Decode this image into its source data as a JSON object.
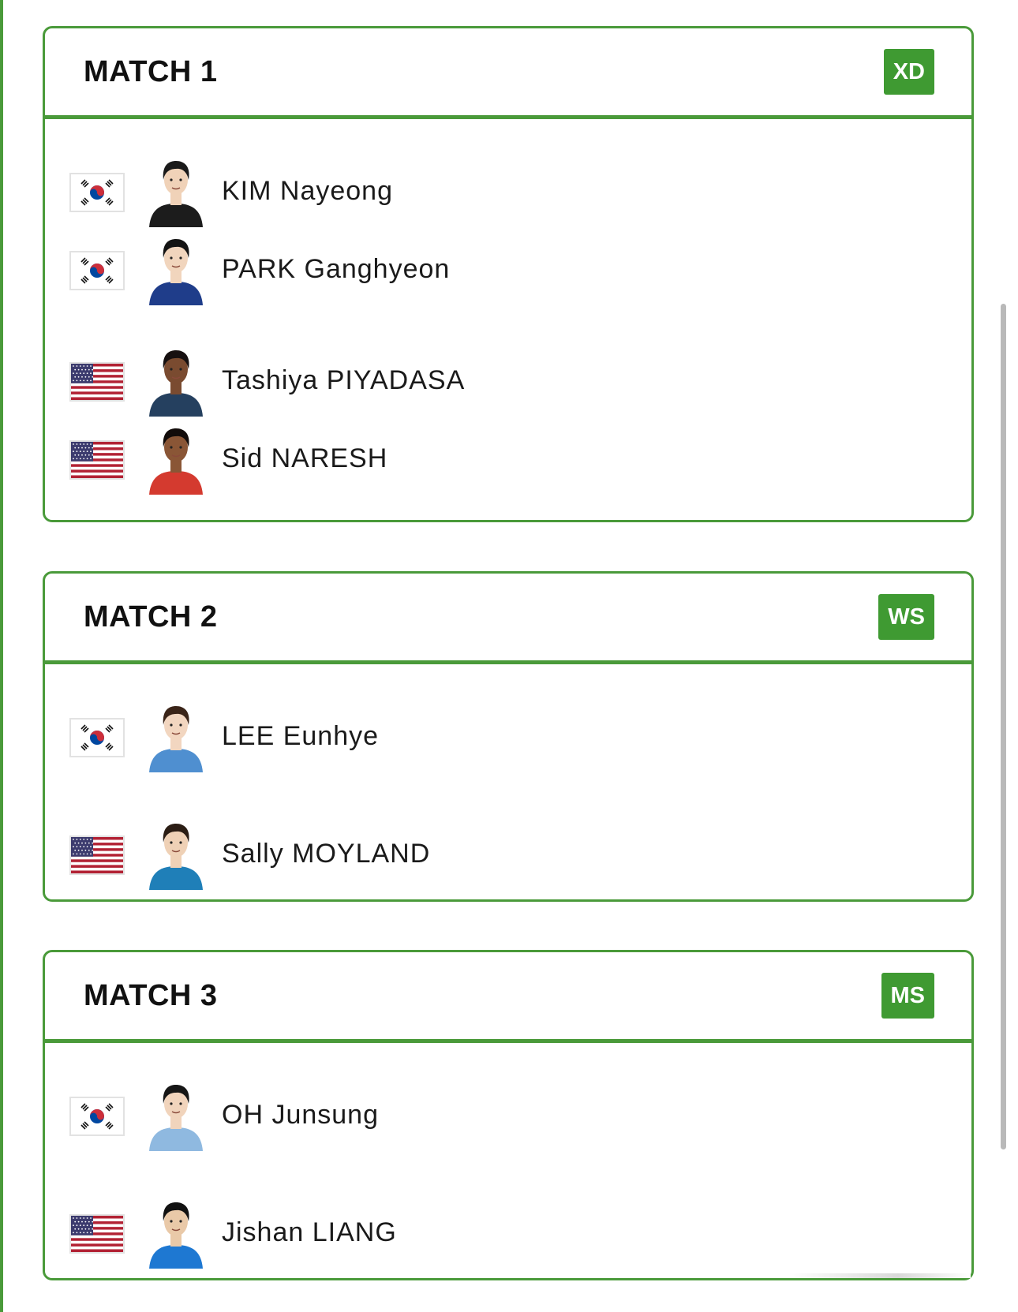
{
  "colors": {
    "accent": "#4a9a3a",
    "badge": "#3f9a32",
    "korea_red": "#cd2e3a",
    "korea_blue": "#0047a0",
    "usa_red": "#b22234",
    "usa_blue": "#3c3b6e"
  },
  "matches": [
    {
      "title": "MATCH 1",
      "event": "XD",
      "players": [
        {
          "name": "KIM Nayeong",
          "flag": "korea-flag-icon",
          "avatar": "player-photo-icon"
        },
        {
          "name": "PARK Ganghyeon",
          "flag": "korea-flag-icon",
          "avatar": "player-photo-icon"
        },
        {
          "name": "Tashiya PIYADASA",
          "flag": "usa-flag-icon",
          "avatar": "player-photo-icon"
        },
        {
          "name": "Sid NARESH",
          "flag": "usa-flag-icon",
          "avatar": "player-photo-icon"
        }
      ]
    },
    {
      "title": "MATCH 2",
      "event": "WS",
      "players": [
        {
          "name": "LEE Eunhye",
          "flag": "korea-flag-icon",
          "avatar": "player-photo-icon"
        },
        {
          "name": "Sally MOYLAND",
          "flag": "usa-flag-icon",
          "avatar": "player-photo-icon"
        }
      ]
    },
    {
      "title": "MATCH 3",
      "event": "MS",
      "players": [
        {
          "name": "OH Junsung",
          "flag": "korea-flag-icon",
          "avatar": "player-photo-icon"
        },
        {
          "name": "Jishan LIANG",
          "flag": "usa-flag-icon",
          "avatar": "player-photo-icon"
        }
      ]
    }
  ]
}
